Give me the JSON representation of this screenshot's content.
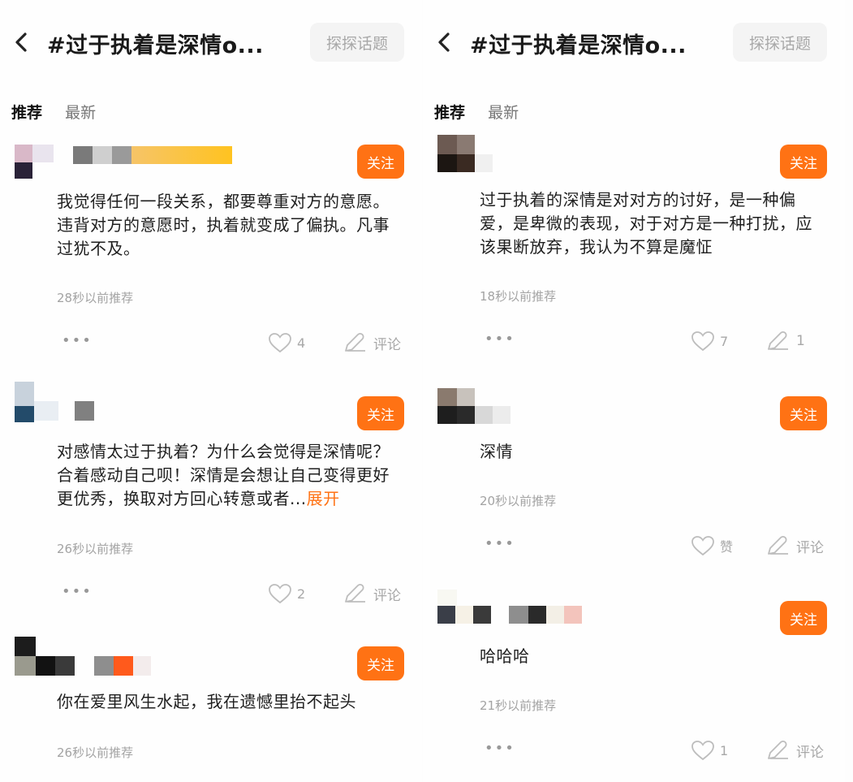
{
  "colors": {
    "accent": "#ff7214",
    "meta": "#a3a3a3"
  },
  "left": {
    "header": {
      "title": "#过于执着是深情o...",
      "explore_label": "探探话题"
    },
    "tabs": [
      "推荐",
      "最新"
    ],
    "posts": [
      {
        "follow": "关注",
        "content": "我觉得任何一段关系，都要尊重对方的意愿。违背对方的意愿时，执着就变成了偏执。凡事过犹不及。",
        "time": "28秒以前推荐",
        "likes": "4",
        "comment": "评论"
      },
      {
        "follow": "关注",
        "content": "对感情太过于执着？为什么会觉得是深情呢？合着感动自己呗！深情是会想让自己变得更好更优秀，换取对方回心转意或者...",
        "expand": "展开",
        "time": "26秒以前推荐",
        "likes": "2",
        "comment": "评论"
      },
      {
        "follow": "关注",
        "content": "你在爱里风生水起，我在遗憾里抬不起头",
        "time": "26秒以前推荐"
      }
    ]
  },
  "right": {
    "header": {
      "title": "#过于执着是深情o...",
      "explore_label": "探探话题"
    },
    "tabs": [
      "推荐",
      "最新"
    ],
    "posts": [
      {
        "follow": "关注",
        "content": "过于执着的深情是对对方的讨好，是一种偏爱，是卑微的表现，对于对方是一种打扰，应该果断放弃，我认为不算是魔怔",
        "time": "18秒以前推荐",
        "likes": "7",
        "comments": "1"
      },
      {
        "follow": "关注",
        "content": "深情",
        "time": "20秒以前推荐",
        "likes": "赞",
        "comment": "评论"
      },
      {
        "follow": "关注",
        "content": "哈哈哈",
        "time": "21秒以前推荐",
        "likes": "1",
        "comment": "评论"
      }
    ]
  }
}
